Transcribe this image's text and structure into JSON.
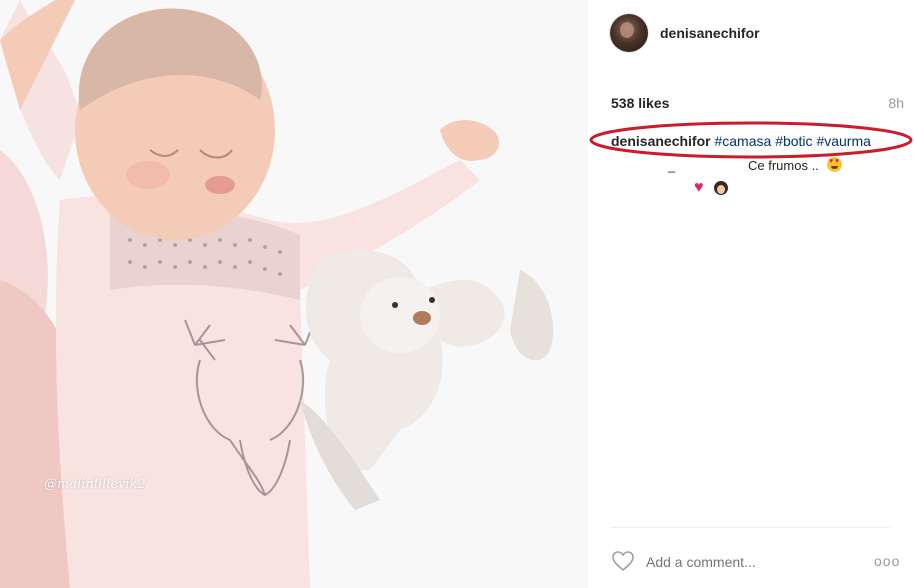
{
  "post": {
    "username": "denisanechifor",
    "likes": "538 likes",
    "time": "8h",
    "watermark": "@malinlillevik2",
    "caption": {
      "user": "denisanechifor",
      "hashtags": [
        "#camasa",
        "#botic",
        "#vaurma"
      ]
    },
    "comment": {
      "prefix": "_",
      "text": "Ce frumos ..",
      "emoji_after_text": "heart-eyes-emoji",
      "second_line_emojis": [
        "red-heart-emoji",
        "girl-emoji"
      ]
    },
    "add_comment_placeholder": "Add a comment...",
    "more_label": "ooo"
  },
  "colors": {
    "hashtag": "#003569",
    "highlight_oval": "#cc1b2a",
    "muted": "#999999"
  }
}
